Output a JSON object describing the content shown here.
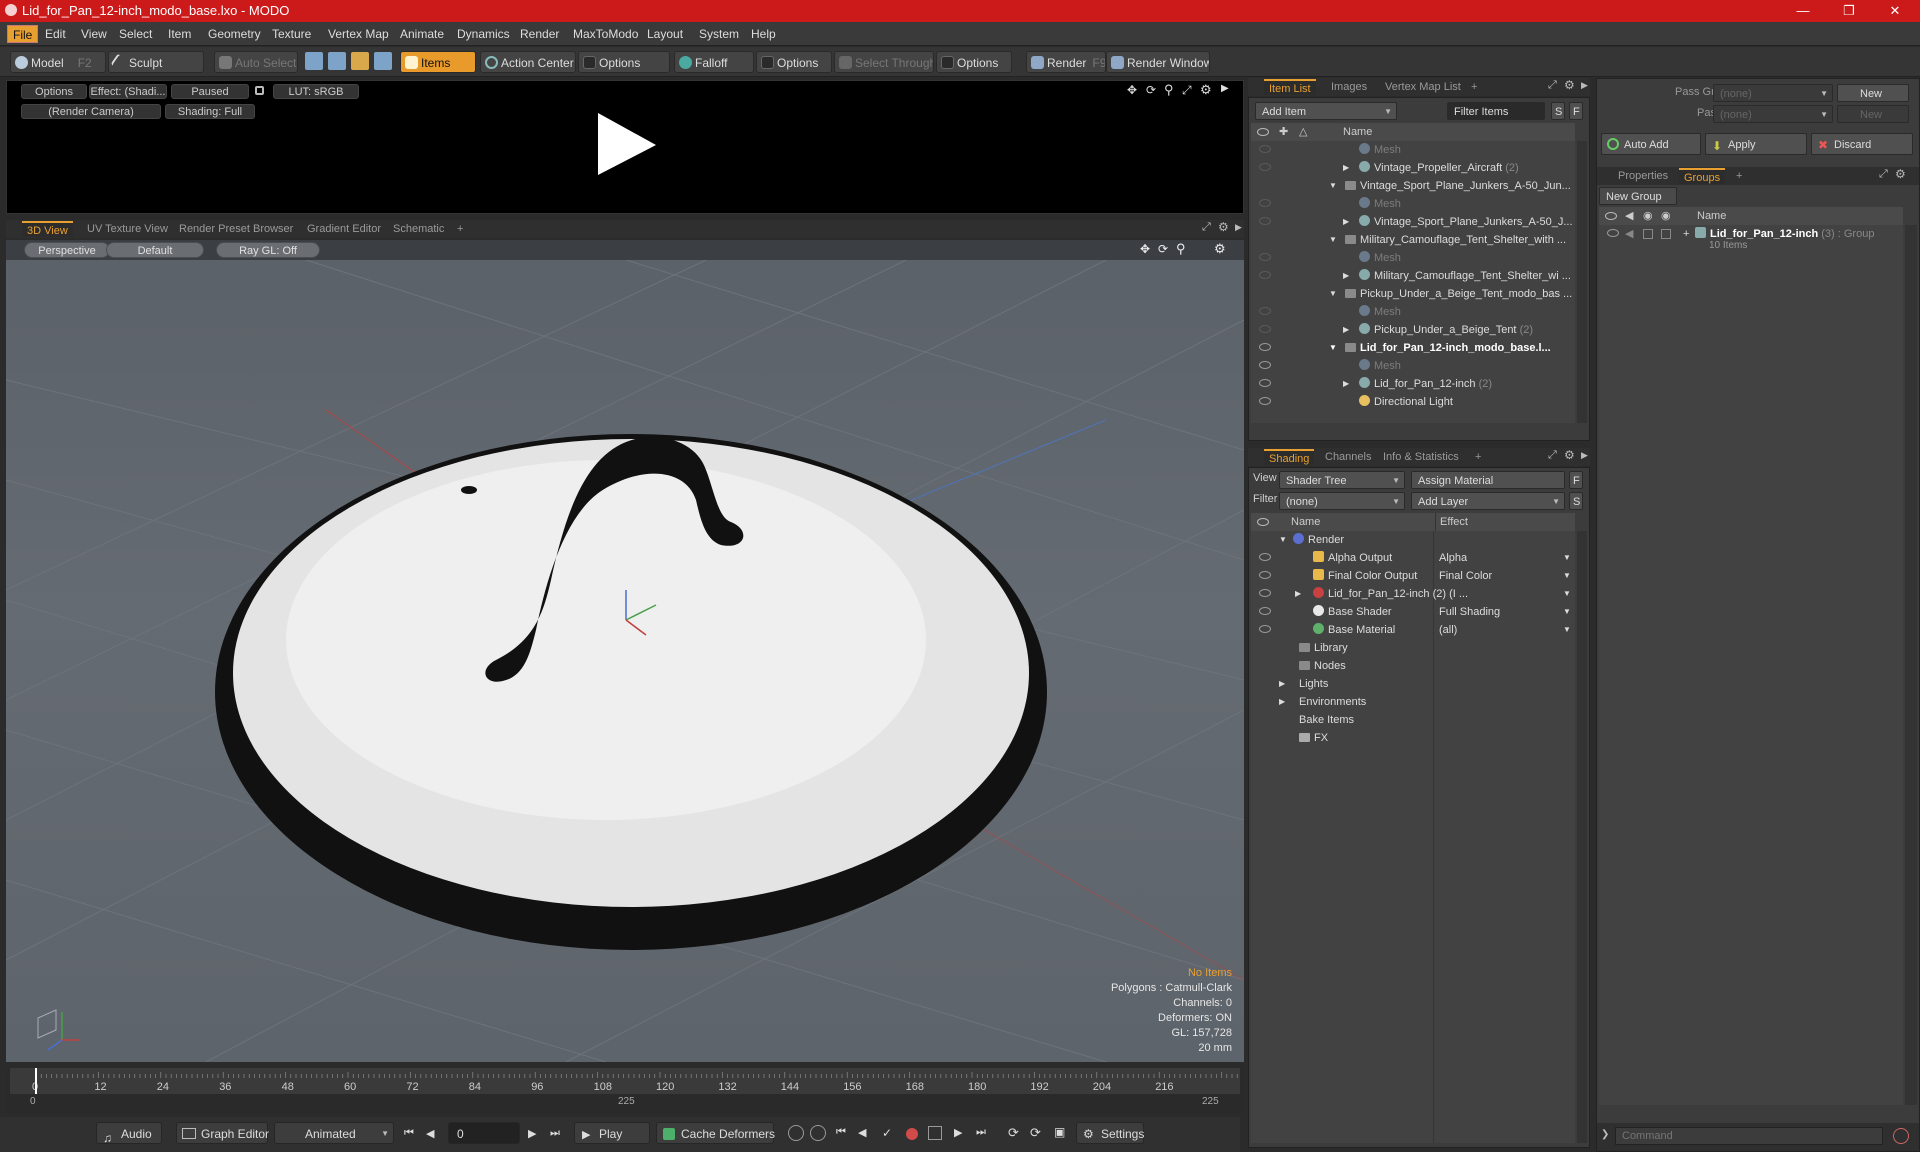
{
  "window": {
    "title": "Lid_for_Pan_12-inch_modo_base.lxo - MODO"
  },
  "menu": [
    "File",
    "Edit",
    "View",
    "Select",
    "Item",
    "Geometry",
    "Texture",
    "Vertex Map",
    "Animate",
    "Dynamics",
    "Render",
    "MaxToModo",
    "Layout",
    "System",
    "Help"
  ],
  "toolbar": {
    "model": "Model",
    "model_key": "F2",
    "sculpt": "Sculpt",
    "auto_select": "Auto Select",
    "items": "Items",
    "action_center": "Action Center",
    "options1": "Options",
    "falloff": "Falloff",
    "options2": "Options",
    "select_through": "Select Through",
    "options3": "Options",
    "render": "Render",
    "render_key": "F9",
    "render_window": "Render Window"
  },
  "preview": {
    "options": "Options",
    "effect": "Effect: (Shadi...",
    "paused": "Paused",
    "lut": "LUT: sRGB",
    "camera": "(Render Camera)",
    "shading": "Shading: Full"
  },
  "view_tabs": [
    "3D View",
    "UV Texture View",
    "Render Preset Browser",
    "Gradient Editor",
    "Schematic"
  ],
  "viewport": {
    "projection": "Perspective",
    "style": "Default",
    "raygl": "Ray GL: Off",
    "stats": [
      "No Items",
      "Polygons : Catmull-Clark",
      "Channels: 0",
      "Deformers: ON",
      "GL: 157,728",
      "20 mm"
    ]
  },
  "timeline": {
    "ticks": [
      "0",
      "12",
      "24",
      "36",
      "48",
      "60",
      "72",
      "84",
      "96",
      "108",
      "120",
      "132",
      "144",
      "156",
      "168",
      "180",
      "192",
      "204",
      "216"
    ],
    "range_start": "0",
    "range_mid": "225",
    "range_end": "225"
  },
  "bottom": {
    "audio": "Audio",
    "graph_editor": "Graph Editor",
    "animated": "Animated",
    "frame": "0",
    "play": "Play",
    "cache": "Cache Deformers",
    "settings": "Settings"
  },
  "item_list": {
    "tabs": [
      "Item List",
      "Images",
      "Vertex Map List"
    ],
    "add_item": "Add Item",
    "filter_items": "Filter Items",
    "col_name": "Name",
    "rows": [
      {
        "label": "Mesh",
        "count": ""
      },
      {
        "label": "Vintage_Propeller_Aircraft",
        "count": "(2)"
      },
      {
        "label": "Vintage_Sport_Plane_Junkers_A-50_Jun...",
        "count": ""
      },
      {
        "label": "Mesh",
        "count": ""
      },
      {
        "label": "Vintage_Sport_Plane_Junkers_A-50_J...",
        "count": ""
      },
      {
        "label": "Military_Camouflage_Tent_Shelter_with ...",
        "count": ""
      },
      {
        "label": "Mesh",
        "count": ""
      },
      {
        "label": "Military_Camouflage_Tent_Shelter_wi ...",
        "count": ""
      },
      {
        "label": "Pickup_Under_a_Beige_Tent_modo_bas ...",
        "count": ""
      },
      {
        "label": "Mesh",
        "count": ""
      },
      {
        "label": "Pickup_Under_a_Beige_Tent",
        "count": "(2)"
      },
      {
        "label": "Lid_for_Pan_12-inch_modo_base.l...",
        "count": ""
      },
      {
        "label": "Mesh",
        "count": ""
      },
      {
        "label": "Lid_for_Pan_12-inch",
        "count": "(2)"
      },
      {
        "label": "Directional Light",
        "count": ""
      }
    ]
  },
  "shading": {
    "tabs": [
      "Shading",
      "Channels",
      "Info & Statistics"
    ],
    "view_label": "View",
    "view_value": "Shader Tree",
    "assign_material": "Assign Material",
    "filter_label": "Filter",
    "filter_value": "(none)",
    "add_layer": "Add Layer",
    "col_name": "Name",
    "col_effect": "Effect",
    "rows": [
      {
        "label": "Render",
        "effect": ""
      },
      {
        "label": "Alpha Output",
        "effect": "Alpha"
      },
      {
        "label": "Final Color Output",
        "effect": "Final Color"
      },
      {
        "label": "Lid_for_Pan_12-inch (2) (I ...",
        "effect": ""
      },
      {
        "label": "Base Shader",
        "effect": "Full Shading"
      },
      {
        "label": "Base Material",
        "effect": "(all)"
      },
      {
        "label": "Library",
        "effect": ""
      },
      {
        "label": "Nodes",
        "effect": ""
      },
      {
        "label": "Lights",
        "effect": ""
      },
      {
        "label": "Environments",
        "effect": ""
      },
      {
        "label": "Bake Items",
        "effect": ""
      },
      {
        "label": "FX",
        "effect": ""
      }
    ]
  },
  "groups": {
    "pass_groups_label": "Pass Groups",
    "pass_groups_value": "(none)",
    "new": "New",
    "passes_label": "Passes",
    "passes_value": "(none)",
    "new2": "New",
    "auto_add": "Auto Add",
    "apply": "Apply",
    "discard": "Discard",
    "tabs": [
      "Properties",
      "Groups"
    ],
    "new_group": "New Group",
    "col_name": "Name",
    "group_name": "Lid_for_Pan_12-inch",
    "group_count": "(3) : Group",
    "group_items": "10 Items",
    "command_placeholder": "Command"
  }
}
